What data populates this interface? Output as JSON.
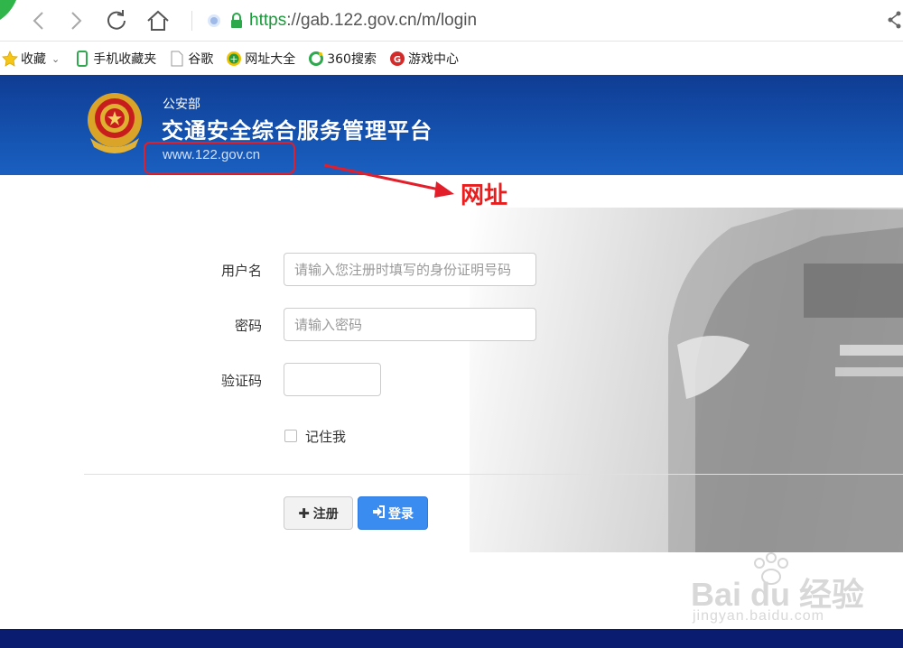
{
  "browser": {
    "url_https": "https",
    "url_rest": "://gab.122.gov.cn/m/login",
    "bookmarks": [
      {
        "icon": "star-icon",
        "label": "收藏"
      },
      {
        "icon": "phone-icon",
        "label": "手机收藏夹"
      },
      {
        "icon": "page-icon",
        "label": "谷歌"
      },
      {
        "icon": "plus-circle-icon",
        "label": "网址大全"
      },
      {
        "icon": "search360-icon",
        "label": "360搜索"
      },
      {
        "icon": "game-icon",
        "label": "游戏中心"
      }
    ]
  },
  "header": {
    "dept": "公安部",
    "title": "交通安全综合服务管理平台",
    "site_url": "www.122.gov.cn"
  },
  "annotation": {
    "text": "网址",
    "color": "#e81d1d"
  },
  "form": {
    "username_label": "用户名",
    "username_placeholder": "请输入您注册时填写的身份证明号码",
    "password_label": "密码",
    "password_placeholder": "请输入密码",
    "captcha_label": "验证码",
    "remember_label": "记住我",
    "register_label": "注册",
    "login_label": "登录"
  },
  "watermark": {
    "brand": "Bai du 经验",
    "domain": "jingyan.baidu.com"
  },
  "colors": {
    "header_blue": "#1656b4",
    "login_blue": "#3b8cf0",
    "footer": "#0a1c70"
  }
}
